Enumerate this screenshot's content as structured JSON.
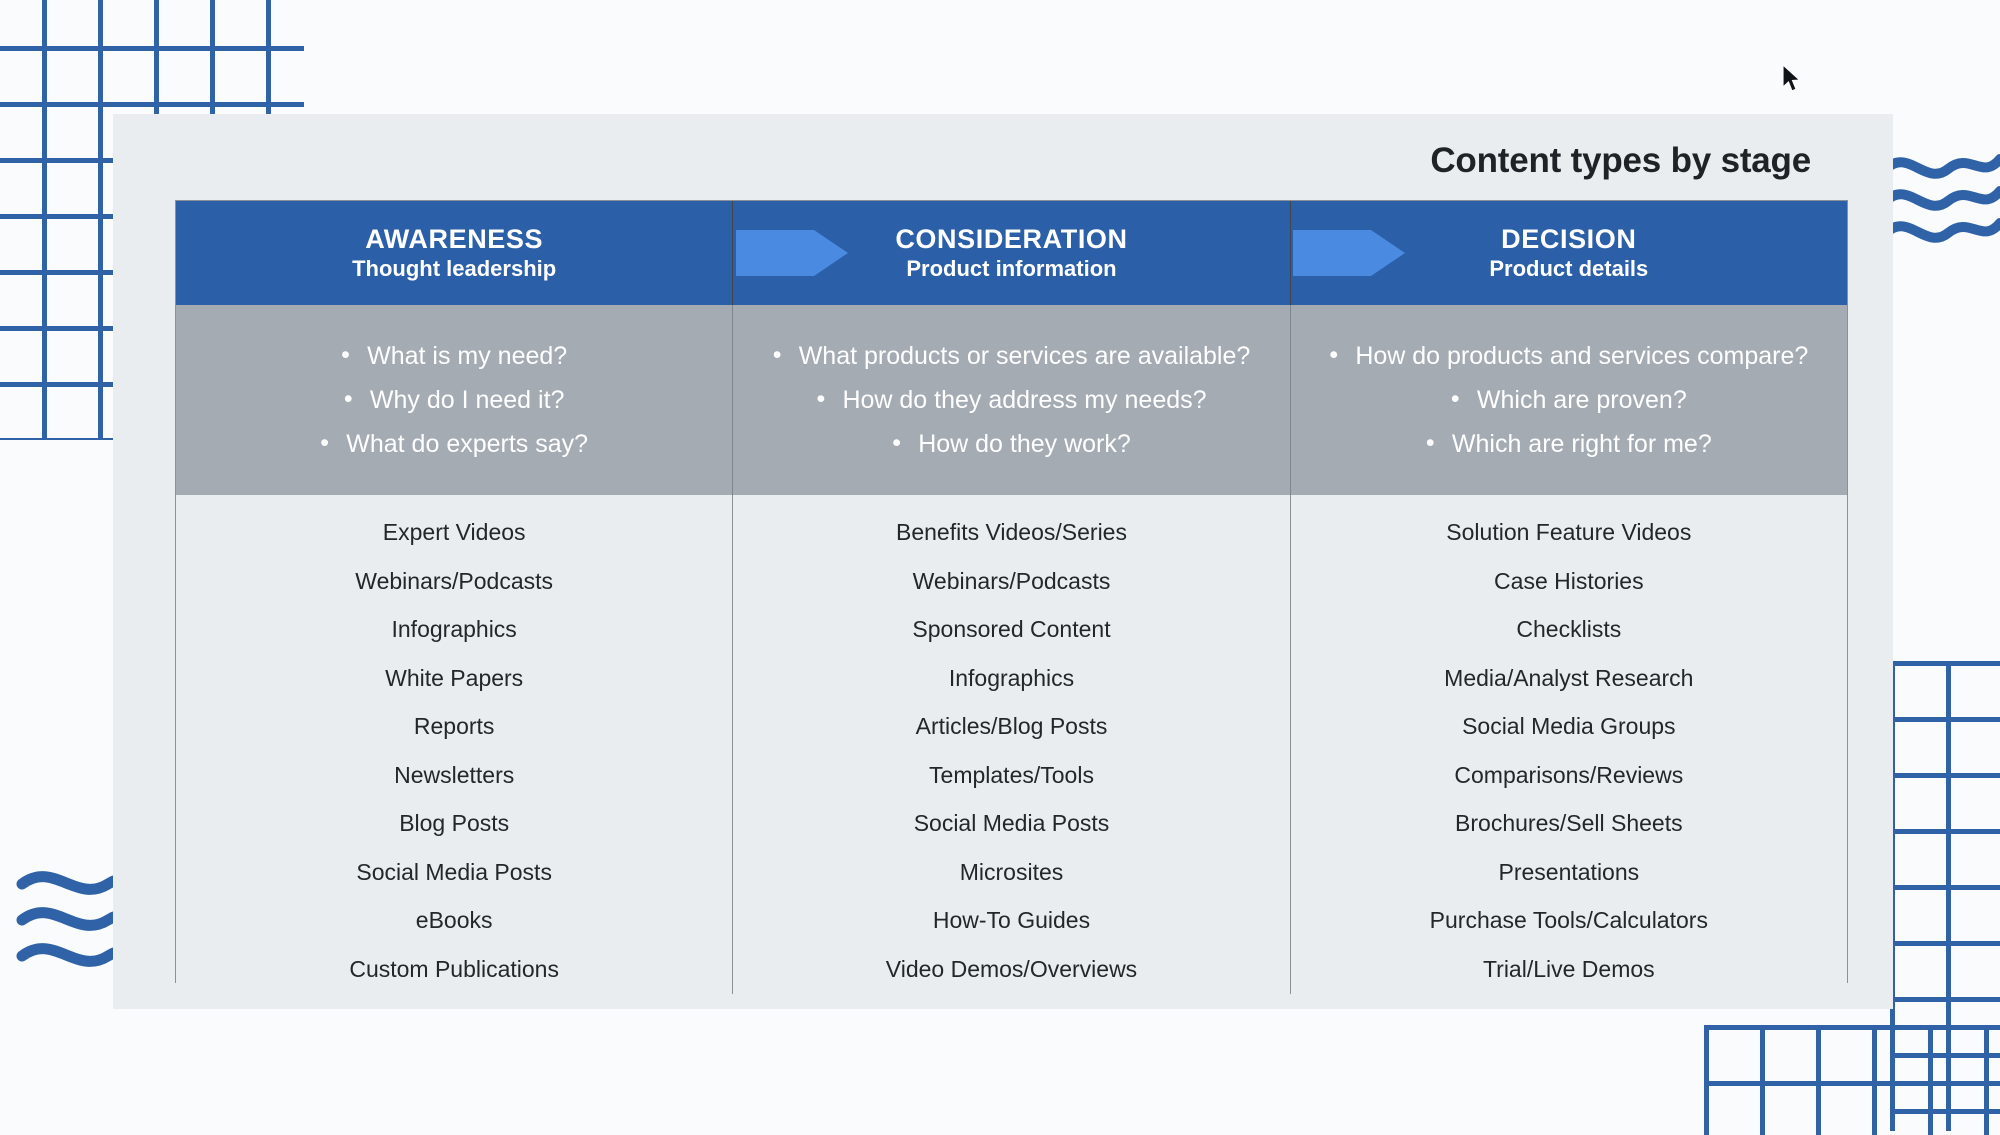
{
  "slide": {
    "title": "Content types by stage",
    "columns": [
      {
        "stage": "AWARENESS",
        "subtitle": "Thought leadership",
        "questions": [
          "What is my need?",
          "Why do I need it?",
          "What do experts say?"
        ],
        "content_types": [
          "Expert Videos",
          "Webinars/Podcasts",
          "Infographics",
          "White Papers",
          "Reports",
          "Newsletters",
          "Blog Posts",
          "Social Media Posts",
          "eBooks",
          "Custom Publications"
        ]
      },
      {
        "stage": "CONSIDERATION",
        "subtitle": "Product information",
        "questions": [
          "What products or services  are available?",
          "How do they address my needs?",
          "How do they work?"
        ],
        "content_types": [
          "Benefits Videos/Series",
          "Webinars/Podcasts",
          "Sponsored Content",
          "Infographics",
          "Articles/Blog Posts",
          "Templates/Tools",
          "Social Media Posts",
          "Microsites",
          "How-To Guides",
          "Video Demos/Overviews"
        ]
      },
      {
        "stage": "DECISION",
        "subtitle": "Product details",
        "questions": [
          "How do products and services compare?",
          "Which are proven?",
          "Which are right for me?"
        ],
        "content_types": [
          "Solution Feature Videos",
          "Case Histories",
          "Checklists",
          "Media/Analyst Research",
          "Social Media Groups",
          "Comparisons/Reviews",
          "Brochures/Sell Sheets",
          "Presentations",
          "Purchase Tools/Calculators",
          "Trial/Live Demos"
        ]
      }
    ]
  },
  "decorations": {
    "grid_top_left": "grid-pattern-icon",
    "grid_bottom_right": "grid-pattern-icon",
    "grid_bottom": "grid-pattern-icon",
    "waves_left": "wave-lines-icon",
    "waves_right": "wave-lines-icon",
    "arrow_1": "arrow-right-icon",
    "arrow_2": "arrow-right-icon",
    "cursor": "mouse-pointer-icon"
  },
  "colors": {
    "header_blue": "#2b5fa7",
    "arrow_blue": "#4a8ae0",
    "questions_gray": "#a4abb3",
    "card_bg": "#e9edf0",
    "grid_blue": "#2f62a6",
    "page_bg": "#fafbfc"
  }
}
